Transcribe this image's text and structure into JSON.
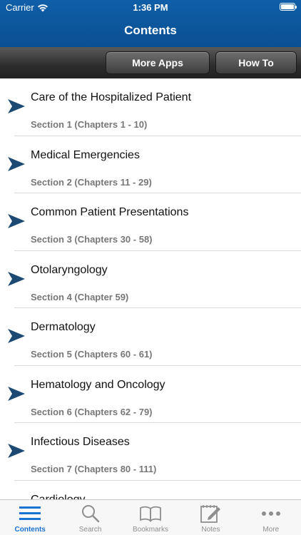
{
  "status": {
    "carrier": "Carrier",
    "time": "1:36 PM"
  },
  "header": {
    "title": "Contents"
  },
  "toolbar": {
    "more_apps_label": "More Apps",
    "how_to_label": "How To"
  },
  "sections": [
    {
      "title": "Care of the Hospitalized Patient",
      "subtitle": "Section 1 (Chapters 1 - 10)"
    },
    {
      "title": "Medical Emergencies",
      "subtitle": "Section 2 (Chapters 11 - 29)"
    },
    {
      "title": "Common Patient Presentations",
      "subtitle": "Section 3 (Chapters 30 - 58)"
    },
    {
      "title": "Otolaryngology",
      "subtitle": "Section 4 (Chapter 59)"
    },
    {
      "title": "Dermatology",
      "subtitle": "Section 5 (Chapters 60 - 61)"
    },
    {
      "title": "Hematology and Oncology",
      "subtitle": "Section 6 (Chapters 62 - 79)"
    },
    {
      "title": "Infectious Diseases",
      "subtitle": "Section 7 (Chapters 80 - 111)"
    },
    {
      "title": "Cardiology",
      "subtitle": ""
    }
  ],
  "tabs": [
    {
      "label": "Contents",
      "icon": "list-icon",
      "active": true
    },
    {
      "label": "Search",
      "icon": "search-icon",
      "active": false
    },
    {
      "label": "Bookmarks",
      "icon": "book-icon",
      "active": false
    },
    {
      "label": "Notes",
      "icon": "notes-icon",
      "active": false
    },
    {
      "label": "More",
      "icon": "more-icon",
      "active": false
    }
  ],
  "colors": {
    "header_blue": "#0a4f92",
    "arrow": "#1d4a73",
    "active_tab": "#1a73d1"
  }
}
